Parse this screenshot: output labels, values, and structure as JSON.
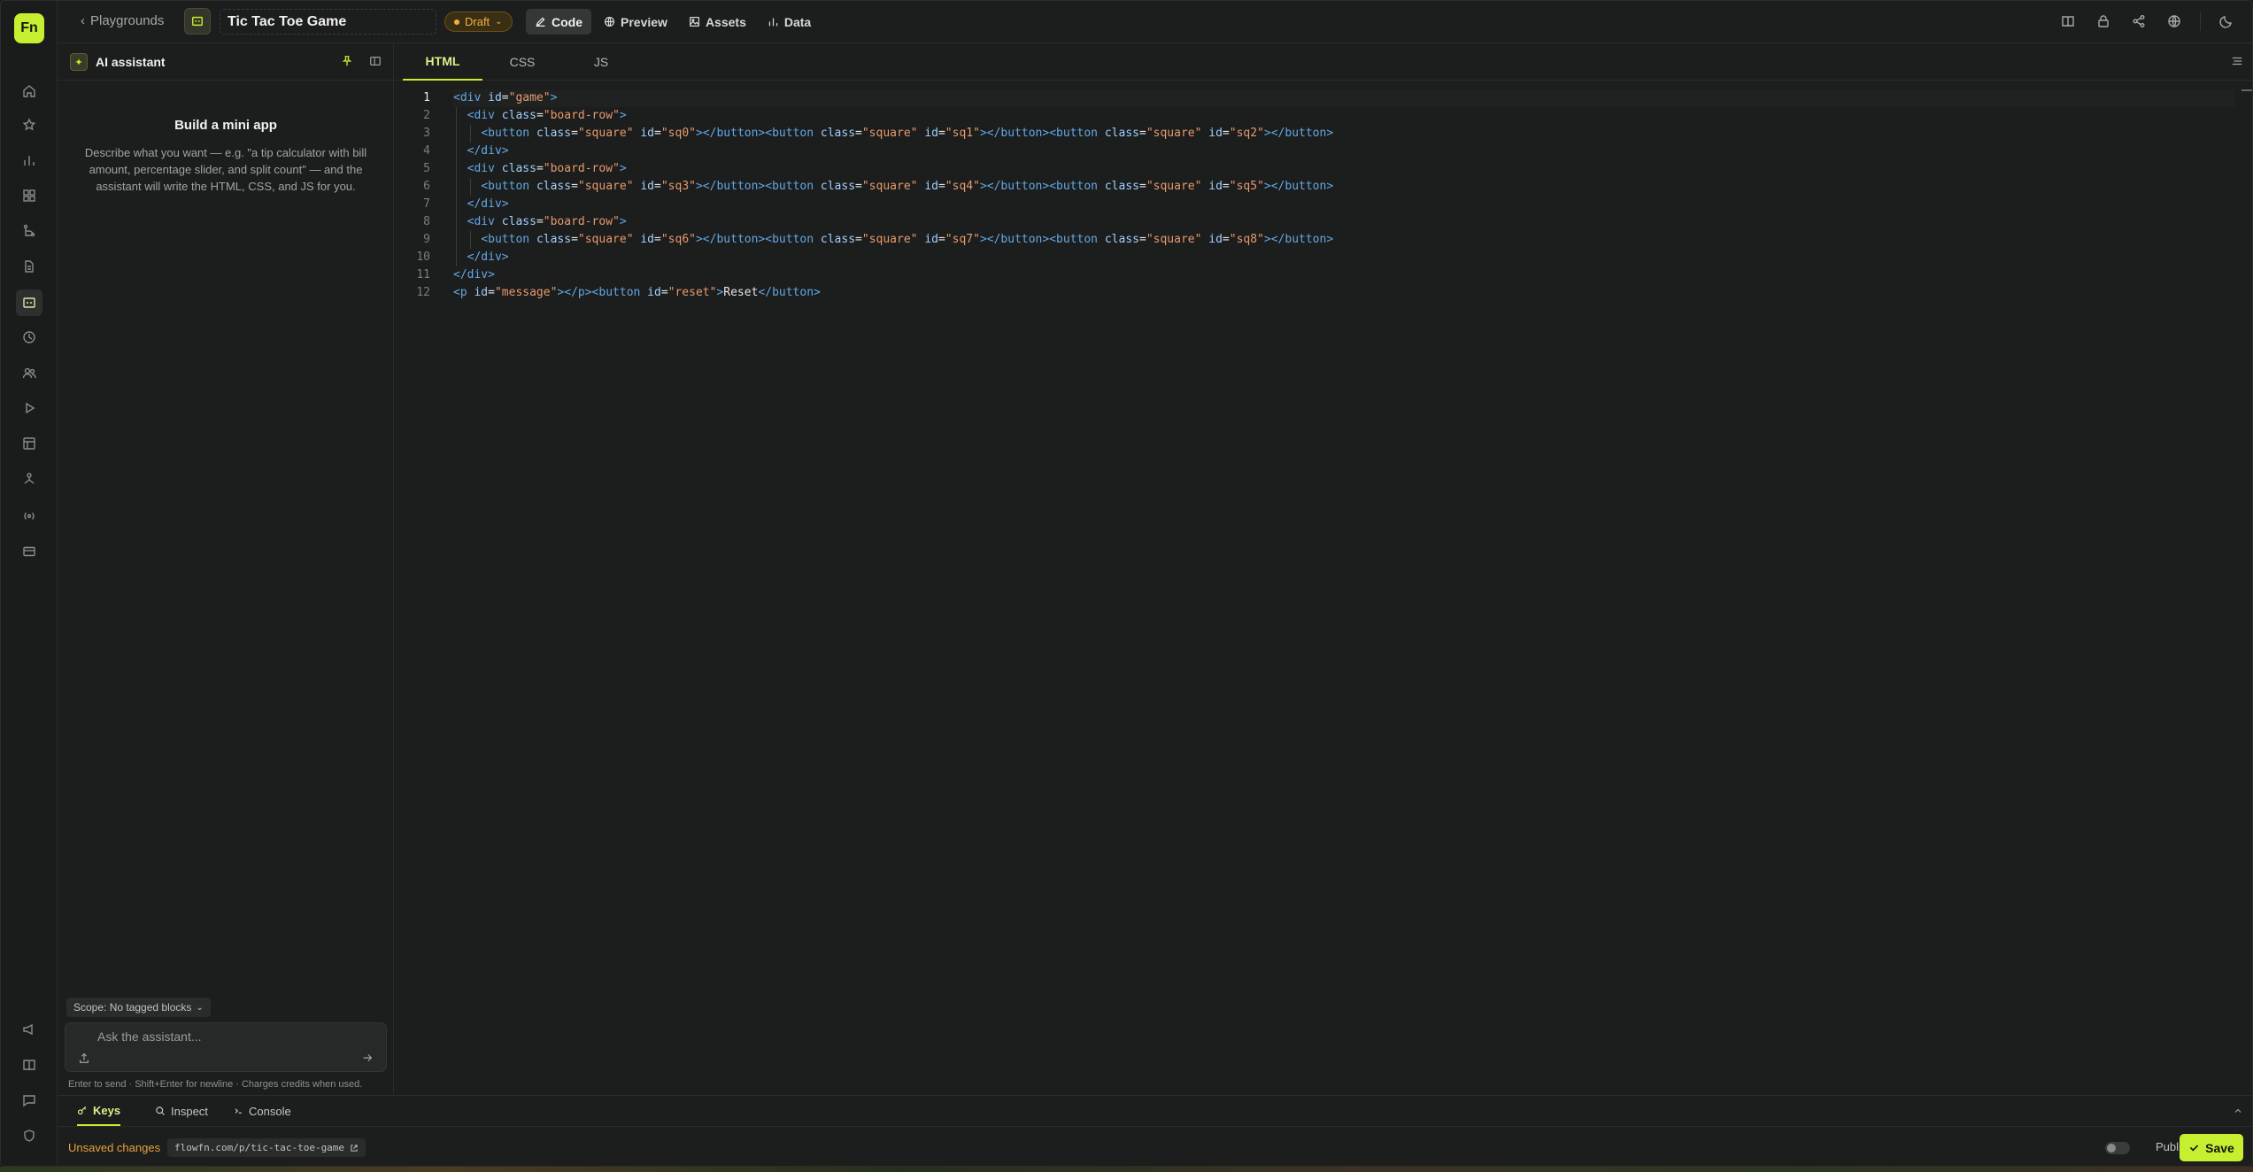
{
  "brand": {
    "logo_text": "Fn",
    "accent": "#c6f02f"
  },
  "topbar": {
    "back_label": "Playgrounds",
    "title": "Tic Tac Toe Game",
    "status": "Draft",
    "modes": [
      {
        "label": "Code",
        "icon": "pencil-icon",
        "active": true
      },
      {
        "label": "Preview",
        "icon": "globe-icon",
        "active": false
      },
      {
        "label": "Assets",
        "icon": "image-icon",
        "active": false
      },
      {
        "label": "Data",
        "icon": "bar-chart-icon",
        "active": false
      }
    ],
    "right_icons": [
      "book-icon",
      "lock-icon",
      "share-icon",
      "globe-icon",
      "moon-icon"
    ]
  },
  "rail": {
    "icons": [
      "home-icon",
      "star-icon",
      "bar-chart-icon",
      "grid-icon",
      "branch-icon",
      "document-icon",
      "playground-icon",
      "clock-icon",
      "users-icon",
      "play-icon",
      "layout-icon",
      "network-icon",
      "broadcast-icon",
      "card-icon"
    ],
    "bottom_icons": [
      "megaphone-icon",
      "book-icon",
      "chat-icon",
      "shield-icon"
    ],
    "active": "playground-icon"
  },
  "ai_panel": {
    "title": "AI assistant",
    "empty_title": "Build a mini app",
    "empty_desc": "Describe what you want — e.g. \"a tip calculator with bill amount, percentage slider, and split count\" — and the assistant will write the HTML, CSS, and JS for you.",
    "scope": "Scope: No tagged blocks",
    "ask_placeholder": "Ask the assistant...",
    "hint": "Enter to send · Shift+Enter for newline · Charges credits when used."
  },
  "editor": {
    "tabs": [
      {
        "label": "HTML",
        "active": true
      },
      {
        "label": "CSS",
        "active": false
      },
      {
        "label": "JS",
        "active": false
      }
    ],
    "line_numbers": [
      "1",
      "2",
      "3",
      "4",
      "5",
      "6",
      "7",
      "8",
      "9",
      "10",
      "11",
      "12"
    ],
    "current_line": 1
  },
  "bottom": {
    "tabs": [
      {
        "label": "Keys",
        "icon": "key-icon",
        "active": true
      },
      {
        "label": "Inspect",
        "icon": "search-icon",
        "active": false
      },
      {
        "label": "Console",
        "icon": "console-icon",
        "active": false
      }
    ],
    "unsaved": "Unsaved changes",
    "url": "flowfn.com/p/tic-tac-toe-game",
    "public_label": "Public",
    "save_label": "Save"
  },
  "colors": {
    "background": "#1c1d1d",
    "draft": "#f0b23c",
    "unsaved": "#e6a23c",
    "tag": "#62a8e6",
    "attr": "#9fd0ff",
    "string": "#e79a6d"
  }
}
